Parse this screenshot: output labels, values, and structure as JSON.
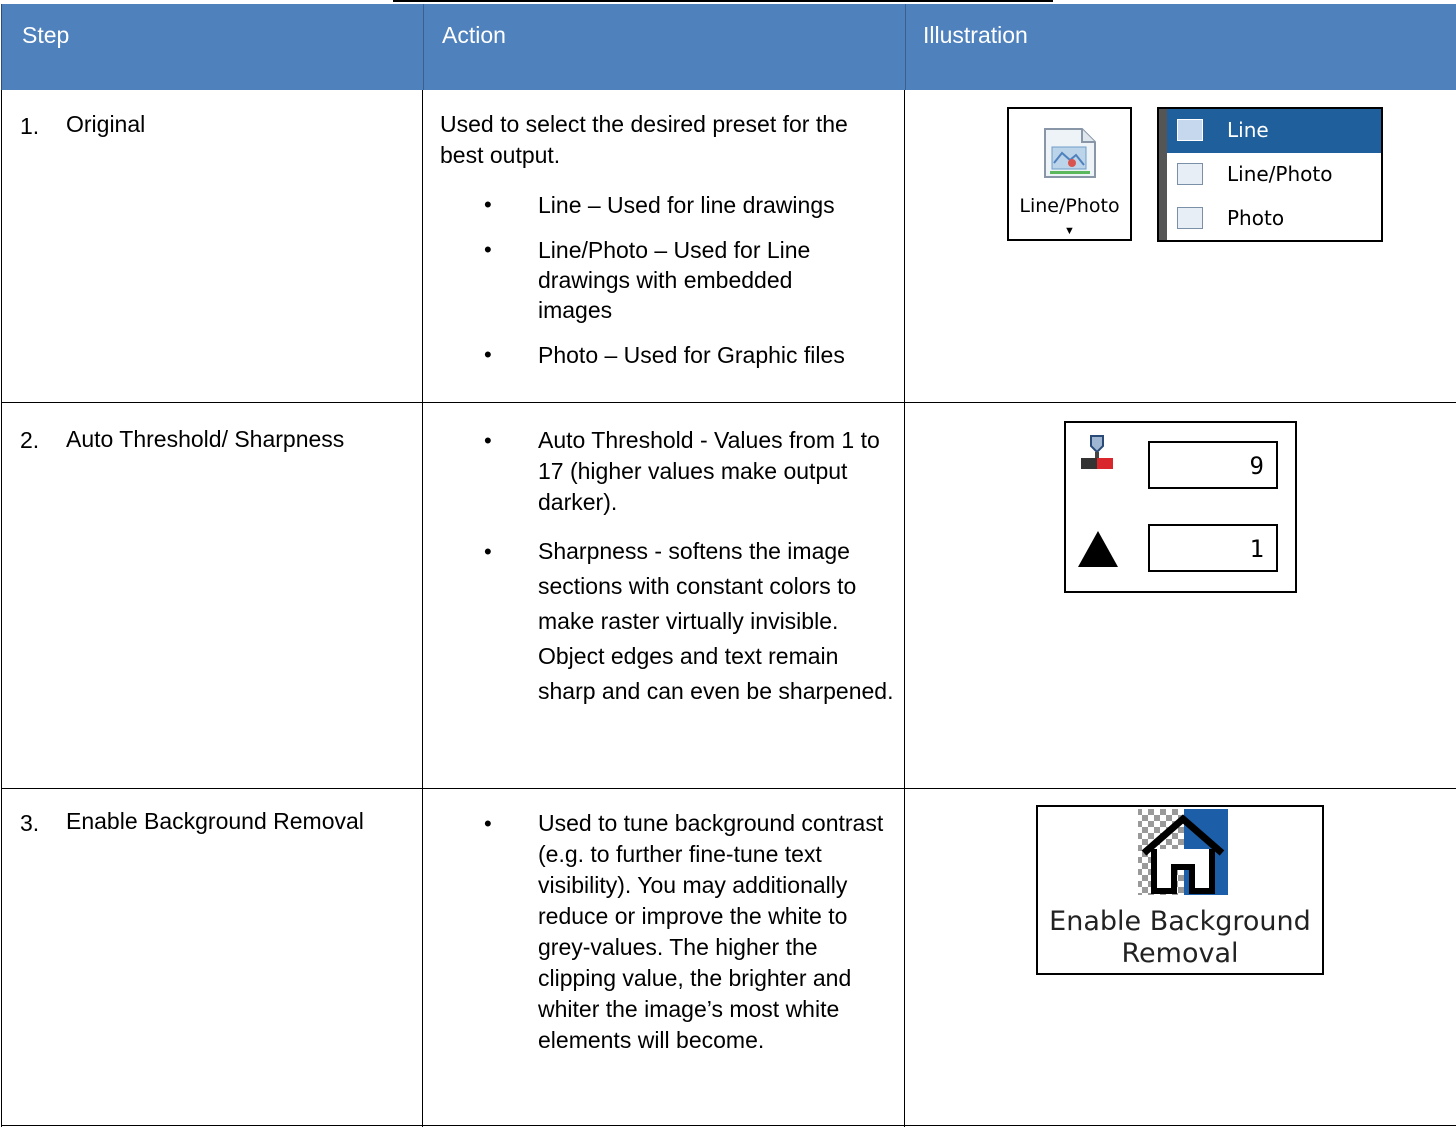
{
  "header": {
    "step": "Step",
    "action": "Action",
    "illustration": "Illustration"
  },
  "rows": [
    {
      "num": "1.",
      "step": "Original",
      "action_intro": "Used to select the desired preset for the best output.",
      "bullets": [
        "Line – Used for line drawings",
        "Line/Photo – Used for Line drawings with embedded images",
        "Photo – Used for Graphic files"
      ],
      "illustration": {
        "button_label": "Line/Photo",
        "menu_items": [
          "Line",
          "Line/Photo",
          "Photo"
        ],
        "selected_item": "Line",
        "selected_color": "#1f5f9b"
      }
    },
    {
      "num": "2.",
      "step": "Auto Threshold/ Sharpness",
      "bullets": [
        "Auto Threshold - Values from 1 to 17 (higher values make output darker).",
        "Sharpness - softens the image sections with constant colors to make raster virtually invisible. Object edges and text remain sharp and can even be sharpened."
      ],
      "illustration": {
        "threshold_value": "9",
        "sharpness_value": "1",
        "threshold_icon": "threshold-slider-icon",
        "sharpness_icon": "triangle-icon"
      }
    },
    {
      "num": "3.",
      "step": "Enable Background Removal",
      "bullets": [
        "Used to tune background contrast (e.g. to further fine-tune text visibility). You may additionally reduce or improve the white to grey-values. The higher the clipping value, the brighter and whiter the image’s most white elements will become."
      ],
      "illustration": {
        "label_line1": "Enable Background",
        "label_line2": "Removal",
        "icon": "house-background-icon"
      }
    }
  ],
  "colors": {
    "header_bg": "#4f81bd",
    "header_text": "#ffffff"
  }
}
